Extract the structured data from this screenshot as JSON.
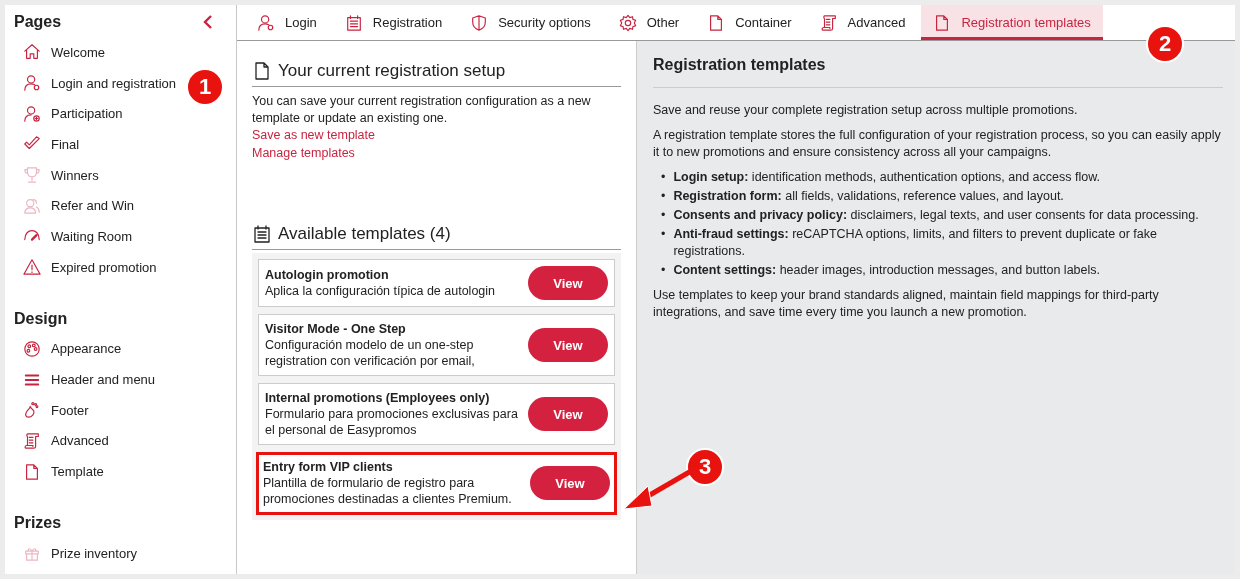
{
  "sidebar": {
    "sections": [
      {
        "title": "Pages",
        "items": [
          {
            "label": "Welcome",
            "faded": false
          },
          {
            "label": "Login and registration",
            "faded": false
          },
          {
            "label": "Participation",
            "faded": false
          },
          {
            "label": "Final",
            "faded": false
          },
          {
            "label": "Winners",
            "faded": true
          },
          {
            "label": "Refer and Win",
            "faded": true
          },
          {
            "label": "Waiting Room",
            "faded": false
          },
          {
            "label": "Expired promotion",
            "faded": false
          }
        ]
      },
      {
        "title": "Design",
        "items": [
          {
            "label": "Appearance",
            "faded": false
          },
          {
            "label": "Header and menu",
            "faded": false
          },
          {
            "label": "Footer",
            "faded": false
          },
          {
            "label": "Advanced",
            "faded": false
          },
          {
            "label": "Template",
            "faded": false
          }
        ]
      },
      {
        "title": "Prizes",
        "items": [
          {
            "label": "Prize inventory",
            "faded": true
          }
        ]
      }
    ]
  },
  "tabs": [
    {
      "label": "Login",
      "selected": false
    },
    {
      "label": "Registration",
      "selected": false
    },
    {
      "label": "Security options",
      "selected": false
    },
    {
      "label": "Other",
      "selected": false
    },
    {
      "label": "Container",
      "selected": false
    },
    {
      "label": "Advanced",
      "selected": false
    },
    {
      "label": "Registration templates",
      "selected": true
    }
  ],
  "current_setup": {
    "title": "Your current registration setup",
    "text": "You can save your current registration configuration as a new template or update an existing one.",
    "links": [
      "Save as new template",
      "Manage templates"
    ]
  },
  "available": {
    "title": "Available templates (4)",
    "templates": [
      {
        "name": "Autologin promotion",
        "description": "Aplica la configuración típica de autologin",
        "button": "View",
        "highlighted": false
      },
      {
        "name": "Visitor Mode - One Step",
        "description": "Configuración modelo de un one-step registration con verificación por email,",
        "button": "View",
        "highlighted": false
      },
      {
        "name": "Internal promotions (Employees only)",
        "description": "Formulario para promociones exclusivas para el personal de Easypromos",
        "button": "View",
        "highlighted": false
      },
      {
        "name": "Entry form VIP clients",
        "description": "Plantilla de formulario de registro para promociones destinadas a clientes Premium.",
        "button": "View",
        "highlighted": true
      }
    ]
  },
  "help": {
    "title": "Registration templates",
    "intro": [
      "Save and reuse your complete registration setup across multiple promotions.",
      "A registration template stores the full configuration of your registration process, so you can easily apply it to new promotions and ensure consistency across all your campaigns."
    ],
    "bullets": [
      {
        "marker": "•",
        "text": "**Login setup:** identification methods, authentication options, and access flow."
      },
      {
        "marker": "•",
        "text": "**Registration form:** all fields, validations, reference values, and layout."
      },
      {
        "marker": "•",
        "text": "**Consents and privacy policy:** disclaimers, legal texts, and user consents for data processing."
      },
      {
        "marker": "•",
        "text": "**Anti-fraud settings:** reCAPTCHA options, limits, and filters to prevent duplicate or fake registrations."
      },
      {
        "marker": "•",
        "text": "**Content settings:** header images, introduction messages, and button labels."
      }
    ],
    "outro": "Use templates to keep your brand standards aligned, maintain field mappings for third-party integrations, and save time every time you launch a new promotion."
  },
  "annotations": [
    {
      "label": "1",
      "arrow": false
    },
    {
      "label": "2",
      "arrow": false
    },
    {
      "label": "3",
      "arrow": true
    }
  ]
}
